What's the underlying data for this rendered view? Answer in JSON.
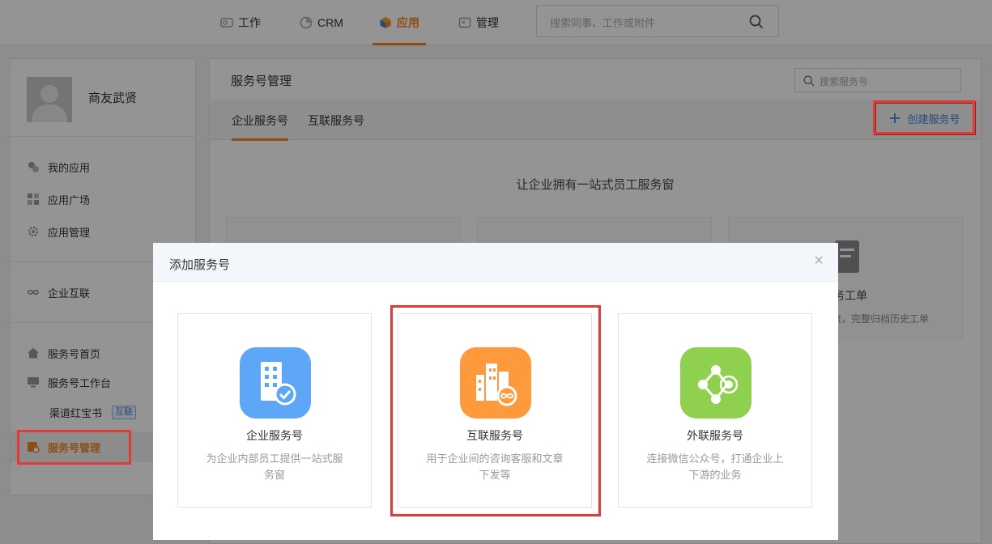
{
  "topnav": {
    "tabs": [
      {
        "label": "工作",
        "icon": "work-icon"
      },
      {
        "label": "CRM",
        "icon": "crm-pie-icon"
      },
      {
        "label": "应用",
        "icon": "app-cube-icon",
        "active": true
      },
      {
        "label": "管理",
        "icon": "manage-icon"
      }
    ],
    "search_placeholder": "搜索同事、工作或附件"
  },
  "sidebar": {
    "username": "商友武贤",
    "items": [
      {
        "label": "我的应用",
        "icon": "my-apps-icon"
      },
      {
        "label": "应用广场",
        "icon": "app-plaza-icon"
      },
      {
        "label": "应用管理",
        "icon": "gear-icon"
      },
      {
        "label": "企业互联",
        "icon": "infinity-icon"
      },
      {
        "label": "服务号首页",
        "icon": "home-icon"
      },
      {
        "label": "服务号工作台",
        "icon": "monitor-icon"
      },
      {
        "label": "渠道红宝书",
        "badge": "互联"
      },
      {
        "label": "服务号管理",
        "icon": "service-manage-icon",
        "active": true
      }
    ]
  },
  "main": {
    "title": "服务号管理",
    "search_placeholder": "搜索服务号",
    "tabs": [
      "企业服务号",
      "互联服务号"
    ],
    "create_button": "创建服务号",
    "slogan": "让企业拥有一站式员工服务窗",
    "bg_card_title": "务工单",
    "bg_card_desc": "流，完整归档历史工单"
  },
  "modal": {
    "title": "添加服务号",
    "close_glyph": "×",
    "cards": [
      {
        "title": "企业服务号",
        "desc": "为企业内部员工提供一站式服务窗",
        "color": "#5ea6f7"
      },
      {
        "title": "互联服务号",
        "desc": "用于企业间的咨询客服和文章下发等",
        "color": "#ff9a3c"
      },
      {
        "title": "外联服务号",
        "desc": "连接微信公众号，打通企业上下游的业务",
        "color": "#8fd14f"
      }
    ]
  },
  "colors": {
    "accent": "#f5841f",
    "highlight": "#e53935",
    "link": "#3f86d6"
  }
}
